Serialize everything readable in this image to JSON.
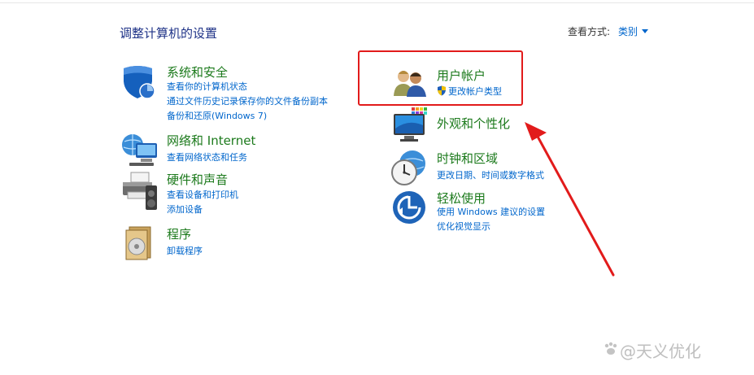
{
  "header": {
    "title": "调整计算机的设置",
    "view_by_label": "查看方式:",
    "view_by_value": "类别"
  },
  "left": [
    {
      "title": "系统和安全",
      "icon": "shield-icon",
      "links": [
        "查看你的计算机状态",
        "通过文件历史记录保存你的文件备份副本",
        "备份和还原(Windows 7)"
      ]
    },
    {
      "title": "网络和 Internet",
      "icon": "network-icon",
      "links": [
        "查看网络状态和任务"
      ]
    },
    {
      "title": "硬件和声音",
      "icon": "printer-icon",
      "links": [
        "查看设备和打印机",
        "添加设备"
      ]
    },
    {
      "title": "程序",
      "icon": "programs-icon",
      "links": [
        "卸载程序"
      ]
    }
  ],
  "right": [
    {
      "title": "用户帐户",
      "icon": "users-icon",
      "links": [
        "更改帐户类型"
      ]
    },
    {
      "title": "外观和个性化",
      "icon": "display-icon",
      "links": []
    },
    {
      "title": "时钟和区域",
      "icon": "clock-icon",
      "links": [
        "更改日期、时间或数字格式"
      ]
    },
    {
      "title": "轻松使用",
      "icon": "ease-of-access-icon",
      "links": [
        "使用 Windows 建议的设置",
        "优化视觉显示"
      ]
    }
  ],
  "watermark": "@天义优化",
  "colors": {
    "link": "#0066cc",
    "heading": "#1c7a1c",
    "annotation": "#e21b1b"
  }
}
